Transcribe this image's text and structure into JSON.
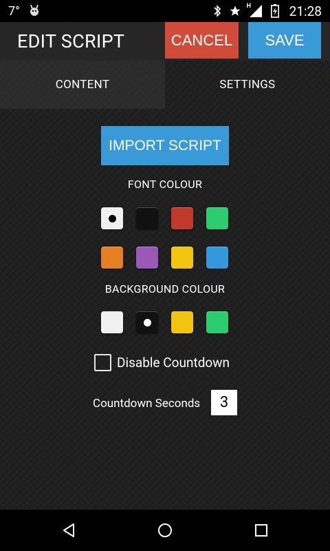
{
  "status": {
    "temperature": "7°",
    "time": "21:28",
    "network_badge": "H"
  },
  "header": {
    "title": "EDIT SCRIPT",
    "cancel_label": "CANCEL",
    "save_label": "SAVE"
  },
  "tabs": [
    {
      "label": "CONTENT",
      "active": true
    },
    {
      "label": "SETTINGS",
      "active": false
    }
  ],
  "content": {
    "import_label": "IMPORT SCRIPT",
    "font_colour_label": "FONT COLOUR",
    "background_colour_label": "BACKGROUND COLOUR",
    "disable_countdown_label": "Disable Countdown",
    "disable_countdown_checked": false,
    "countdown_seconds_label": "Countdown Seconds",
    "countdown_seconds_value": "3"
  },
  "colors": {
    "accent_blue": "#3a9ad8",
    "cancel_red": "#d14b3a",
    "font_swatches": [
      "#f0f0f0",
      "#111111",
      "#c0392b",
      "#2ecc71",
      "#e67e22",
      "#9b59b6",
      "#f1c40f",
      "#3498db"
    ],
    "font_selected_index": 0,
    "background_swatches": [
      "#f0f0f0",
      "#111111",
      "#f1c40f",
      "#2ecc71"
    ],
    "background_selected_index": 1
  },
  "icons": {
    "status_left": [
      "android-debug-icon"
    ],
    "status_right": [
      "bluetooth-icon",
      "star-icon",
      "signal-icon",
      "battery-icon"
    ],
    "nav": [
      "back-icon",
      "home-icon",
      "recents-icon"
    ]
  }
}
